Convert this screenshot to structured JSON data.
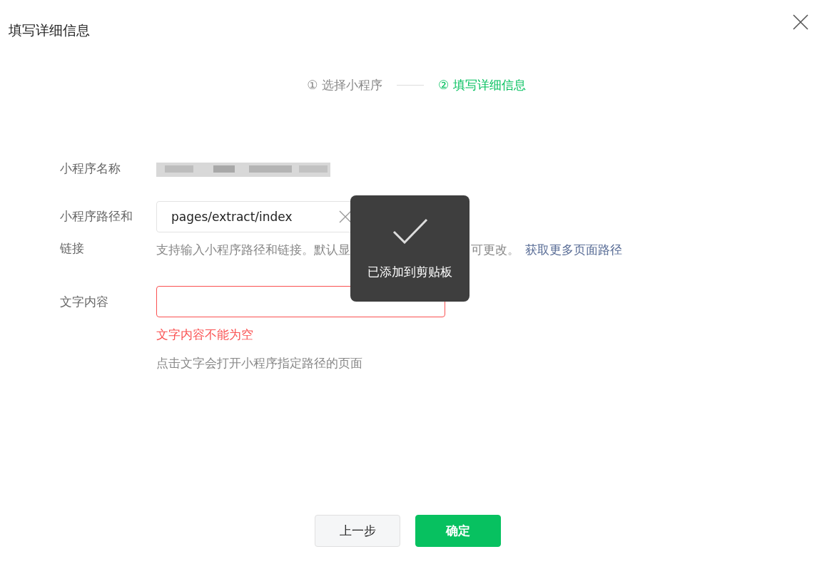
{
  "dialog": {
    "title": "填写详细信息"
  },
  "steps": [
    {
      "number": "①",
      "label": "选择小程序",
      "selected": false
    },
    {
      "number": "②",
      "label": "填写详细信息",
      "selected": true
    }
  ],
  "form": {
    "name_label": "小程序名称",
    "path_label": "小程序路径和链接",
    "path_value": "pages/extract/index",
    "path_hint_start": "支持输入小程序路径和链接。默认显",
    "path_hint_end": "可更改。",
    "path_link": "获取更多页面路径",
    "text_label": "文字内容",
    "text_error": true,
    "text_error_message": "文字内容不能为空",
    "text_hint": "点击文字会打开小程序指定路径的页面"
  },
  "toast": {
    "message": "已添加到剪贴板"
  },
  "buttons": [
    {
      "label": "上一步",
      "kind": "secondary"
    },
    {
      "label": "确定",
      "kind": "primary"
    }
  ]
}
